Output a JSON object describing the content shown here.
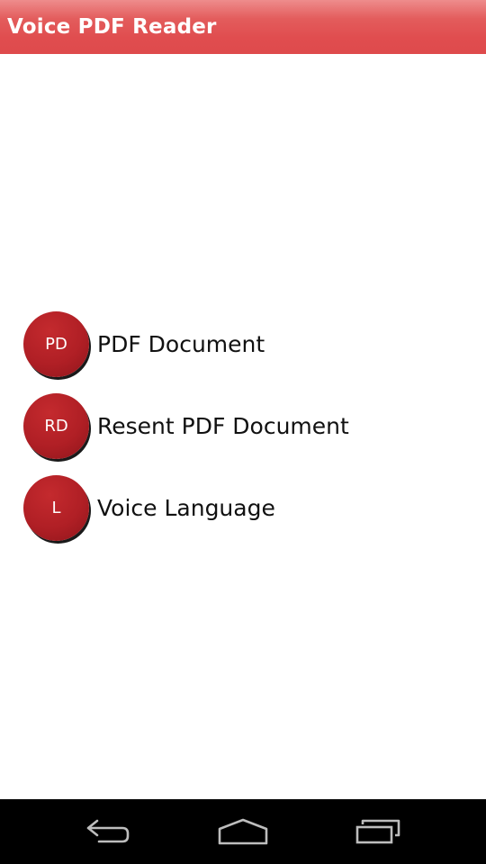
{
  "app_title": "Voice PDF Reader",
  "menu": {
    "items": [
      {
        "icon_text": "PD",
        "label": "PDF Document"
      },
      {
        "icon_text": "RD",
        "label": "Resent PDF Document"
      },
      {
        "icon_text": "L",
        "label": "Voice Language"
      }
    ]
  },
  "navigation": {
    "buttons": [
      "back-icon",
      "home-icon",
      "recent-apps-icon"
    ]
  },
  "colors": {
    "title_bar": "#e04d4f",
    "icon_circle": "#b01f25",
    "nav_bar": "#000000"
  }
}
